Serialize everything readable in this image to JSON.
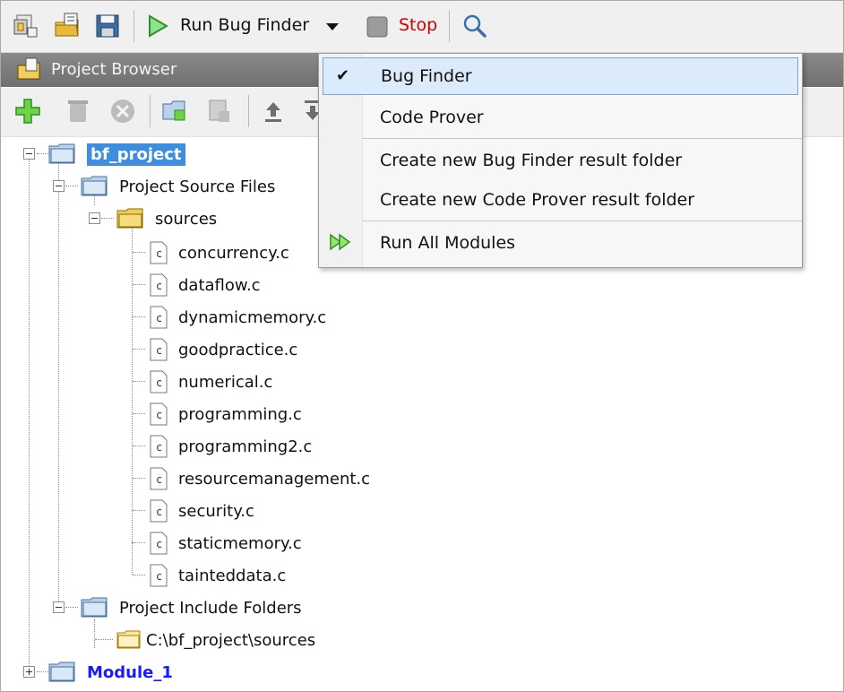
{
  "toolbar": {
    "run_label": "Run Bug Finder",
    "stop_label": "Stop",
    "icons": [
      "new-project-icon",
      "open-project-icon",
      "save-icon",
      "run-icon",
      "dropdown-arrow-icon",
      "stop-icon",
      "search-icon"
    ]
  },
  "project_browser": {
    "title": "Project Browser",
    "toolbar_icons": [
      "add-icon",
      "delete-icon",
      "remove-icon",
      "add-folder-icon",
      "import-icon",
      "upload-icon",
      "download-icon"
    ]
  },
  "tree": {
    "project": "bf_project",
    "source_files": "Project Source Files",
    "sources_folder": "sources",
    "files": [
      "concurrency.c",
      "dataflow.c",
      "dynamicmemory.c",
      "goodpractice.c",
      "numerical.c",
      "programming.c",
      "programming2.c",
      "resourcemanagement.c",
      "security.c",
      "staticmemory.c",
      "tainteddata.c"
    ],
    "include_folders": "Project Include Folders",
    "include_path": "C:\\bf_project\\sources",
    "module": "Module_1"
  },
  "menu": {
    "items": [
      {
        "label": "Bug Finder",
        "checked": true
      },
      {
        "label": "Code Prover"
      },
      {
        "label": "Create new Bug Finder result folder"
      },
      {
        "label": "Create new Code Prover result folder"
      },
      {
        "label": "Run All Modules"
      }
    ]
  },
  "colors": {
    "selection": "#3e8ee0",
    "module_text": "#1a1aff",
    "stop_text": "#d00000",
    "highlight": "#dcebfb"
  }
}
